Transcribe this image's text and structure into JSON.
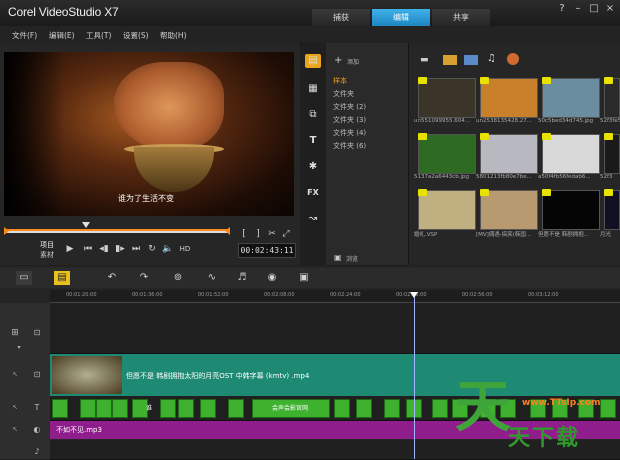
{
  "app": {
    "title": "Corel VideoStudio X7"
  },
  "window_controls": {
    "help": "?",
    "minimize": "–",
    "maximize": "□",
    "close": "×"
  },
  "tabs": [
    {
      "label": "捕获"
    },
    {
      "label": "编辑"
    },
    {
      "label": "共享"
    }
  ],
  "menu": [
    {
      "label": "文件(F)"
    },
    {
      "label": "编辑(E)"
    },
    {
      "label": "工具(T)"
    },
    {
      "label": "设置(S)"
    },
    {
      "label": "帮助(H)"
    }
  ],
  "preview": {
    "subtitle": "谁为了生活不变",
    "mode_project": "项目",
    "mode_clip": "素材",
    "timecode": "00:02:43:11",
    "hd_label": "HD"
  },
  "library": {
    "add_label": "添加",
    "browse_label": "浏览",
    "folders": [
      "样本",
      "文件夹",
      "文件夹 (2)",
      "文件夹 (3)",
      "文件夹 (4)",
      "文件夹 (6)"
    ],
    "thumbs": [
      {
        "label": "un551099955.604...",
        "color": "#3a3528"
      },
      {
        "label": "un2538135428.27...",
        "color": "#c8802a"
      },
      {
        "label": "50c5bed34d745.jpg",
        "color": "#6a8ea0"
      },
      {
        "label": "52f3fe5",
        "color": "#2a2a2a"
      },
      {
        "label": "5137a2a6443cb.jpg",
        "color": "#2e6a22"
      },
      {
        "label": "5801213fb80e7be...",
        "color": "#b8b8c0"
      },
      {
        "label": "a50f4fb56fedab6...",
        "color": "#d8d8d8"
      },
      {
        "label": "52f3",
        "color": "#1a1a1a"
      },
      {
        "label": "婚礼.VSP",
        "color": "#c0b080"
      },
      {
        "label": "[MV]偶遇-搞笑(韩国...",
        "color": "#b89a70"
      },
      {
        "label": "但愿不是 韩剧拥抱...",
        "color": "#050505"
      },
      {
        "label": "月光",
        "color": "#101020"
      }
    ]
  },
  "timeline": {
    "ruler": [
      "00:01:20:00",
      "00:01:36:00",
      "00:01:52:00",
      "00:02:08:00",
      "00:02:24:00",
      "00:02:40:00",
      "00:02:56:00",
      "00:03:12:00"
    ],
    "video_clip_label": "但愿不是 韩剧拥抱太阳的月亮OST 中韩字幕 (kmtv) .mp4",
    "title_chips": [
      "谁",
      "会声会影官网"
    ],
    "audio_clip_label": "不如不见.mp3"
  },
  "watermark": {
    "site": "www.TTsIp.com",
    "logo_char": "天",
    "text": "天下载"
  },
  "colors": {
    "accent": "#1d86c3",
    "video_track": "#1e8a74",
    "audio_track": "#8f1e8c",
    "title_track": "#3eb22f",
    "scrub": "#ff8a1c"
  }
}
